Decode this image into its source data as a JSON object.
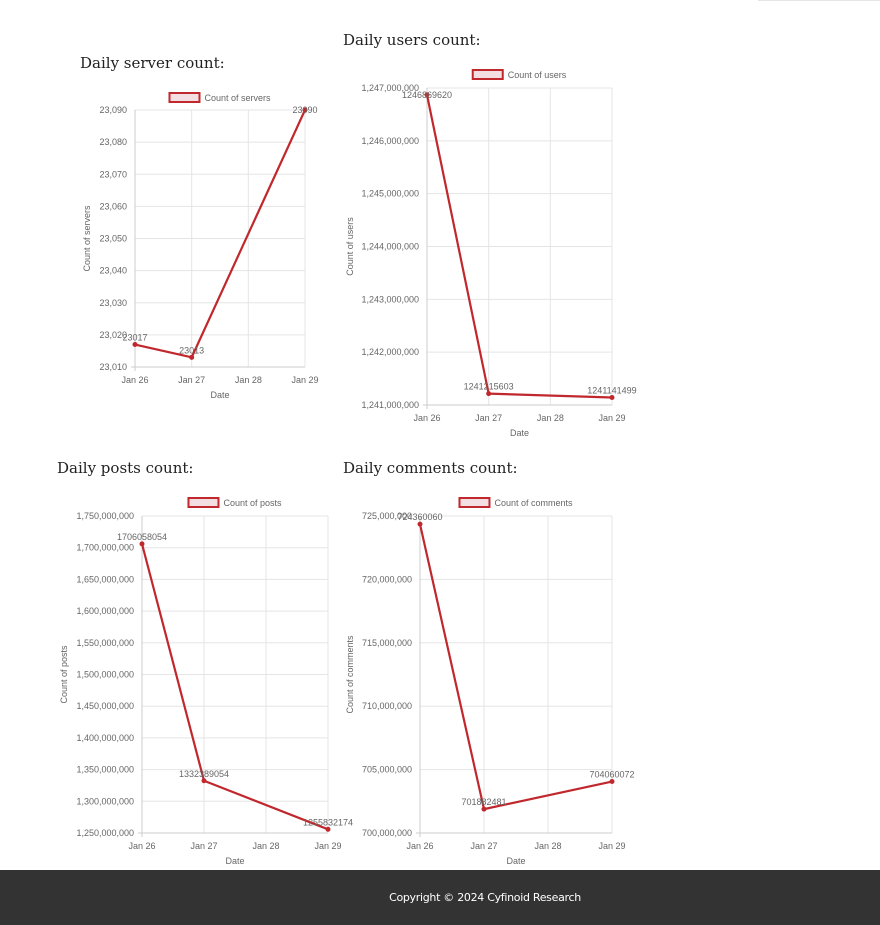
{
  "headings": {
    "servers": "Daily server count:",
    "users": "Daily users count:",
    "posts": "Daily posts count:",
    "comments": "Daily comments count:"
  },
  "footer": {
    "copyright": "Copyright © 2024 Cyfinoid Research"
  },
  "colors": {
    "line": "#c0282d",
    "legend_fill": "#f3dfe1",
    "grid": "#e5e5e5",
    "text": "#666666"
  },
  "chart_data": [
    {
      "id": "servers",
      "type": "line",
      "x": [
        "Jan 26",
        "Jan 27",
        "Jan 28",
        "Jan 29"
      ],
      "series": [
        {
          "name": "Count of servers",
          "points": [
            [
              0,
              23017
            ],
            [
              1,
              23013
            ],
            [
              3,
              23090
            ]
          ]
        }
      ],
      "data_labels": [
        "23017",
        "23013",
        "23090"
      ],
      "xlabel": "Date",
      "ylabel": "Count of servers",
      "ylim": [
        23010,
        23090
      ],
      "yticks": [
        23010,
        23020,
        23030,
        23040,
        23050,
        23060,
        23070,
        23080,
        23090
      ],
      "grid": true,
      "legend": "top"
    },
    {
      "id": "users",
      "type": "line",
      "x": [
        "Jan 26",
        "Jan 27",
        "Jan 28",
        "Jan 29"
      ],
      "series": [
        {
          "name": "Count of users",
          "points": [
            [
              0,
              1246869620
            ],
            [
              1,
              1241215603
            ],
            [
              3,
              1241141499
            ]
          ]
        }
      ],
      "data_labels": [
        "1246869620",
        "1241215603",
        "1241141499"
      ],
      "xlabel": "Date",
      "ylabel": "Count of users",
      "ylim": [
        1241000000,
        1247000000
      ],
      "yticks": [
        1241000000,
        1242000000,
        1243000000,
        1244000000,
        1245000000,
        1246000000,
        1247000000
      ],
      "grid": true,
      "legend": "top"
    },
    {
      "id": "posts",
      "type": "line",
      "x": [
        "Jan 26",
        "Jan 27",
        "Jan 28",
        "Jan 29"
      ],
      "series": [
        {
          "name": "Count of posts",
          "points": [
            [
              0,
              1706058054
            ],
            [
              1,
              1332389054
            ],
            [
              3,
              1255832174
            ]
          ]
        }
      ],
      "data_labels": [
        "1706058054",
        "1332389054",
        "1255832174"
      ],
      "xlabel": "Date",
      "ylabel": "Count of posts",
      "ylim": [
        1250000000,
        1750000000
      ],
      "yticks": [
        1250000000,
        1300000000,
        1350000000,
        1400000000,
        1450000000,
        1500000000,
        1550000000,
        1600000000,
        1650000000,
        1700000000,
        1750000000
      ],
      "grid": true,
      "legend": "top"
    },
    {
      "id": "comments",
      "type": "line",
      "x": [
        "Jan 26",
        "Jan 27",
        "Jan 28",
        "Jan 29"
      ],
      "series": [
        {
          "name": "Count of comments",
          "points": [
            [
              0,
              724360060
            ],
            [
              1,
              701882481
            ],
            [
              3,
              704060072
            ]
          ]
        }
      ],
      "data_labels": [
        "724360060",
        "701882481",
        "704060072"
      ],
      "xlabel": "Date",
      "ylabel": "Count of comments",
      "ylim": [
        700000000,
        725000000
      ],
      "yticks": [
        700000000,
        705000000,
        710000000,
        715000000,
        720000000,
        725000000
      ],
      "grid": true,
      "legend": "top"
    }
  ]
}
